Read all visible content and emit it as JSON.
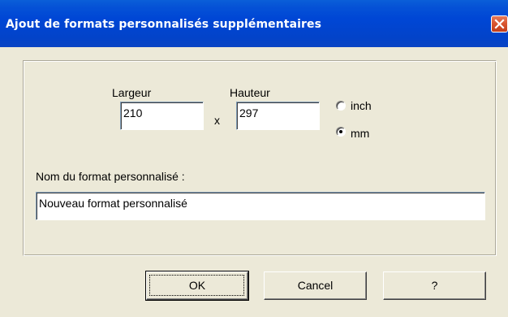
{
  "window": {
    "title": "Ajout de formats personnalisés supplémentaires"
  },
  "form": {
    "width_label": "Largeur",
    "width_value": "210",
    "separator": "x",
    "height_label": "Hauteur",
    "height_value": "297",
    "unit_options": [
      {
        "label": "inch",
        "selected": false
      },
      {
        "label": "mm",
        "selected": true
      }
    ],
    "name_label": "Nom du format personnalisé :",
    "name_value": "Nouveau format personnalisé"
  },
  "buttons": {
    "ok": "OK",
    "cancel": "Cancel",
    "help": "?"
  }
}
